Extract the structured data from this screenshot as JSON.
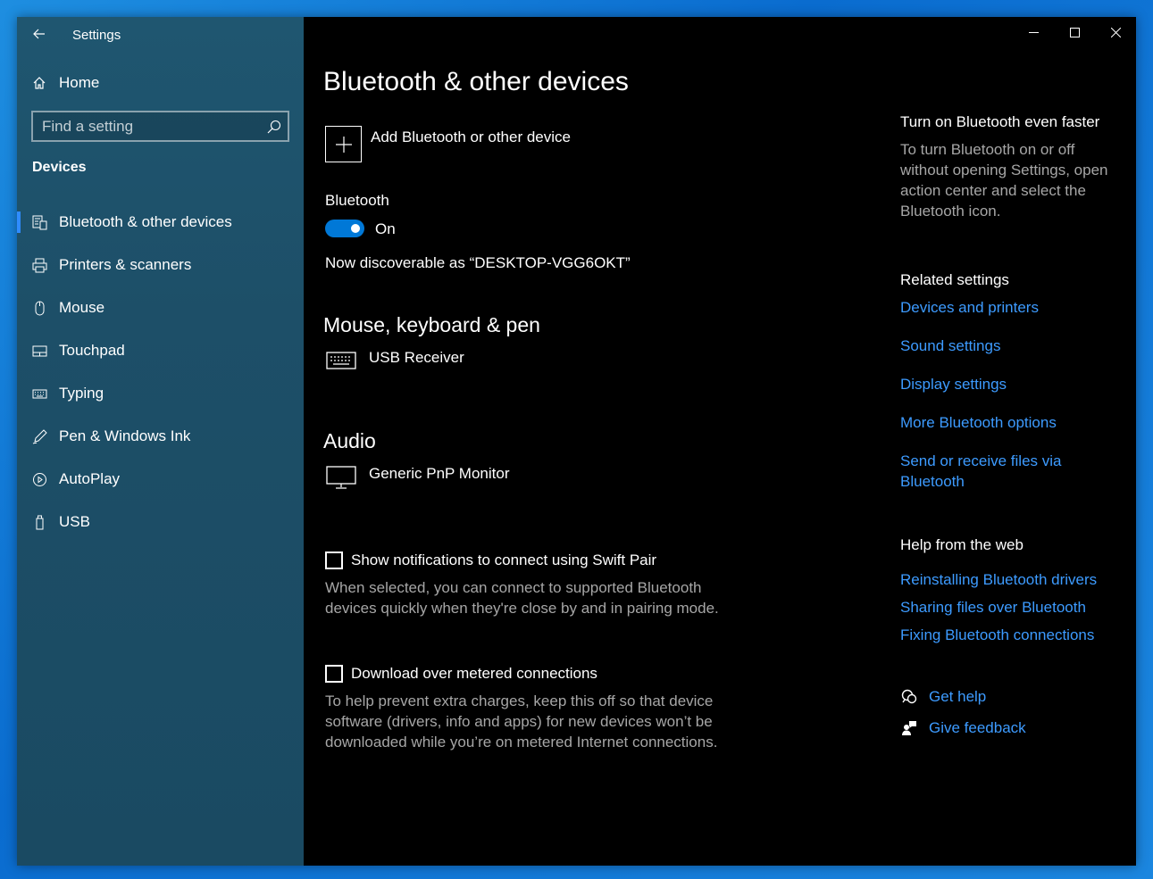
{
  "window": {
    "title": "Settings"
  },
  "sidebar": {
    "home_label": "Home",
    "search_placeholder": "Find a setting",
    "section_label": "Devices",
    "items": [
      {
        "label": "Bluetooth & other devices",
        "icon": "bluetooth-devices-icon",
        "active": true
      },
      {
        "label": "Printers & scanners",
        "icon": "printer-icon"
      },
      {
        "label": "Mouse",
        "icon": "mouse-icon"
      },
      {
        "label": "Touchpad",
        "icon": "touchpad-icon"
      },
      {
        "label": "Typing",
        "icon": "keyboard-icon"
      },
      {
        "label": "Pen & Windows Ink",
        "icon": "pen-icon"
      },
      {
        "label": "AutoPlay",
        "icon": "autoplay-icon"
      },
      {
        "label": "USB",
        "icon": "usb-icon"
      }
    ]
  },
  "main": {
    "title": "Bluetooth & other devices",
    "add_device_label": "Add Bluetooth or other device",
    "bluetooth": {
      "label": "Bluetooth",
      "state": "On",
      "discoverable_text": "Now discoverable as “DESKTOP-VGG6OKT”"
    },
    "groups": [
      {
        "heading": "Mouse, keyboard & pen",
        "device": "USB Receiver",
        "icon": "keyboard-icon"
      },
      {
        "heading": "Audio",
        "device": "Generic PnP Monitor",
        "icon": "monitor-icon"
      }
    ],
    "options": [
      {
        "label": "Show notifications to connect using Swift Pair",
        "checked": false,
        "description": "When selected, you can connect to supported Bluetooth devices quickly when they're close by and in pairing mode."
      },
      {
        "label": "Download over metered connections",
        "checked": false,
        "description": "To help prevent extra charges, keep this off so that device software (drivers, info and apps) for new devices won’t be downloaded while you’re on metered Internet connections."
      }
    ]
  },
  "right": {
    "tip_heading": "Turn on Bluetooth even faster",
    "tip_text": "To turn Bluetooth on or off without opening Settings, open action center and select the Bluetooth icon.",
    "related_heading": "Related settings",
    "related_links": [
      "Devices and printers",
      "Sound settings",
      "Display settings",
      "More Bluetooth options",
      "Send or receive files via Bluetooth"
    ],
    "web_heading": "Help from the web",
    "web_links": [
      "Reinstalling Bluetooth drivers",
      "Sharing files over Bluetooth",
      "Fixing Bluetooth connections"
    ],
    "get_help": "Get help",
    "give_feedback": "Give feedback"
  },
  "colors": {
    "accent": "#0078d7",
    "link": "#3d9bff",
    "sidebar": "#1f5670",
    "main_bg": "#000000"
  }
}
